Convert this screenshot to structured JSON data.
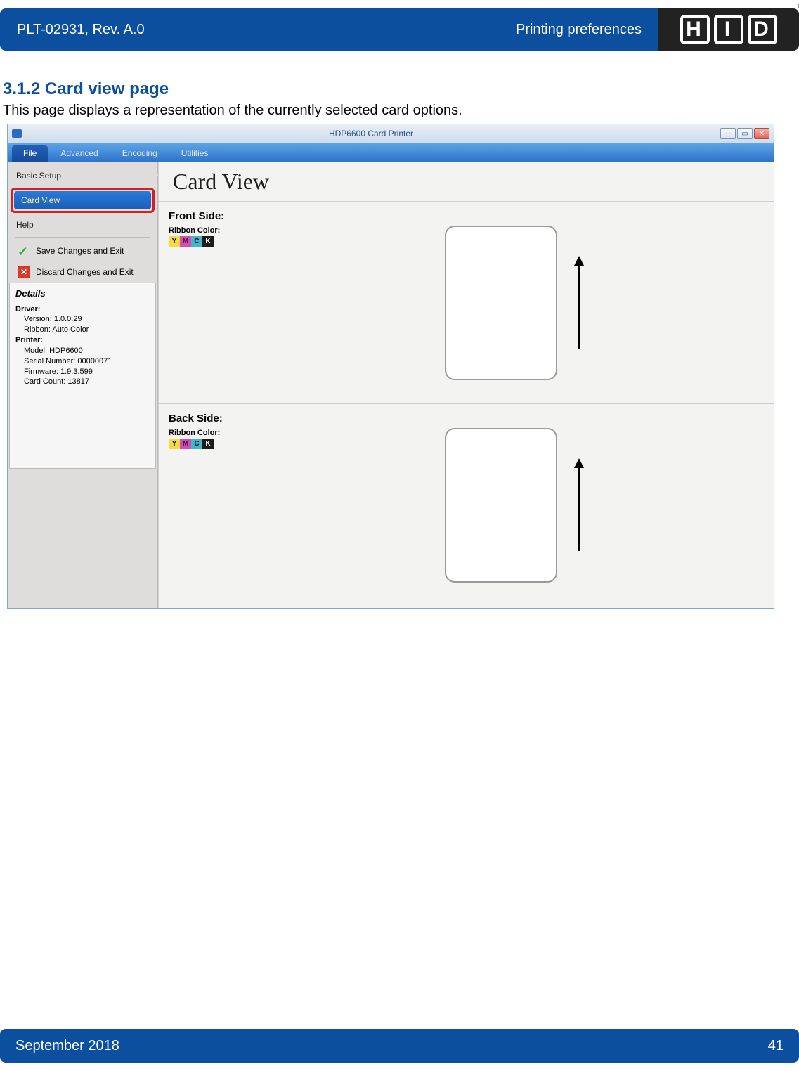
{
  "doc": {
    "header_left": "PLT-02931, Rev. A.0",
    "header_right": "Printing preferences",
    "logo_text": "HID",
    "reg": "®",
    "section_number_title": "3.1.2 Card view page",
    "section_desc": "This page displays a representation of the currently selected card options.",
    "footer_date": "September 2018",
    "footer_page": "41"
  },
  "window": {
    "title": "HDP6600 Card Printer",
    "menus": [
      "File",
      "Advanced",
      "Encoding",
      "Utilities"
    ],
    "menu_active_index": 0,
    "sidebar": {
      "items": [
        "Basic Setup",
        "Card View",
        "Help"
      ],
      "selected_index": 1,
      "actions": [
        {
          "icon": "check",
          "label": "Save Changes and Exit"
        },
        {
          "icon": "x",
          "label": "Discard Changes and Exit"
        }
      ]
    },
    "details": {
      "title": "Details",
      "driver_label": "Driver:",
      "driver_version_label": "Version:",
      "driver_version": "1.0.0.29",
      "driver_ribbon_label": "Ribbon:",
      "driver_ribbon": "Auto Color",
      "printer_label": "Printer:",
      "printer_model_label": "Model:",
      "printer_model": "HDP6600",
      "printer_serial_label": "Serial Number:",
      "printer_serial": "00000071",
      "printer_firmware_label": "Firmware:",
      "printer_firmware": "1.9.3.599",
      "printer_cardcount_label": "Card Count:",
      "printer_cardcount": "13817"
    },
    "main": {
      "heading": "Card View",
      "front_label": "Front Side:",
      "back_label": "Back Side:",
      "ribbon_color_label": "Ribbon Color:",
      "ribbon_chips": [
        "Y",
        "M",
        "C",
        "K"
      ]
    }
  }
}
